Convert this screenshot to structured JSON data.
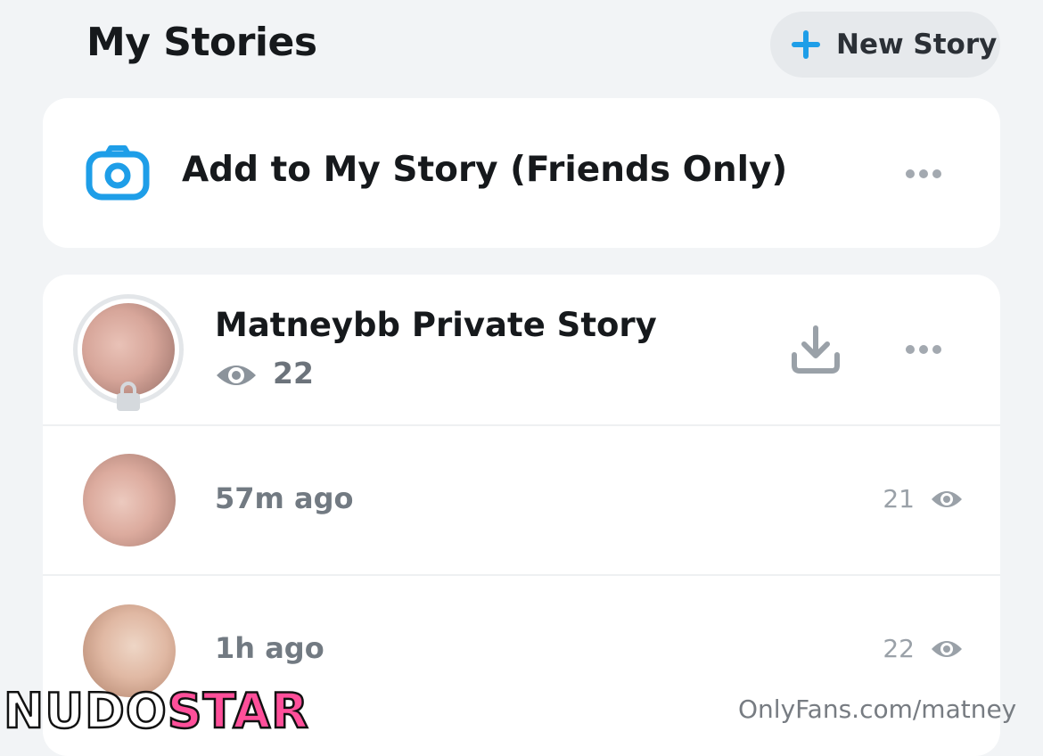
{
  "header": {
    "title": "My Stories",
    "new_story_label": "New Story"
  },
  "add_story": {
    "label": "Add to My Story (Friends Only)"
  },
  "private_story": {
    "title": "Matneybb Private Story",
    "views": "22"
  },
  "snaps": [
    {
      "time": "57m ago",
      "views": "21"
    },
    {
      "time": "1h ago",
      "views": "22"
    }
  ],
  "watermarks": {
    "left_part1": "NUDO",
    "left_part2": "STAR",
    "right": "OnlyFans.com/matney"
  },
  "colors": {
    "accent": "#1e9ee8",
    "watermark_pink": "#ff4f9a"
  }
}
